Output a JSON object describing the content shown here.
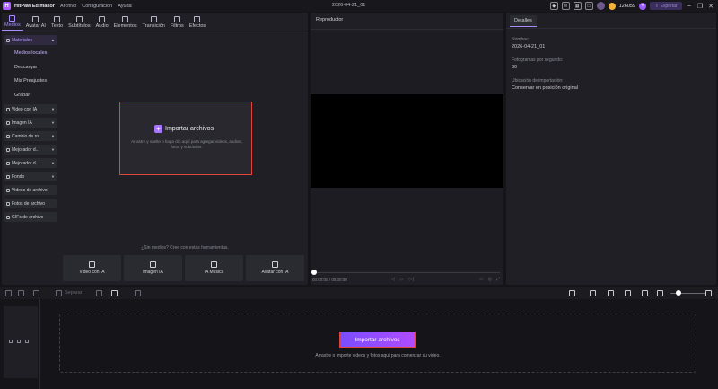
{
  "app": {
    "name": "HitPaw Edimakor",
    "project_title": "2026-04-21_01",
    "menu": [
      "Archivo",
      "Configuración",
      "Ayuda"
    ],
    "credits": "126059",
    "export_label": "Exportar"
  },
  "toolbar": {
    "tools": [
      {
        "label": "Medios",
        "icon": "folder-icon"
      },
      {
        "label": "Avatar AI",
        "icon": "avatar-icon"
      },
      {
        "label": "Texto",
        "icon": "text-icon"
      },
      {
        "label": "Subtítulos",
        "icon": "subtitles-icon"
      },
      {
        "label": "Audio",
        "icon": "music-icon"
      },
      {
        "label": "Elementos",
        "icon": "elements-icon"
      },
      {
        "label": "Transición",
        "icon": "transition-icon"
      },
      {
        "label": "Filtros",
        "icon": "filter-icon"
      },
      {
        "label": "Efectos",
        "icon": "effects-icon"
      }
    ]
  },
  "sidebar": {
    "materiales": "Materiales",
    "sub_items": [
      "Medios locales",
      "Descargar",
      "Mis Preajustes",
      "Grabar"
    ],
    "groups": [
      "Video con IA",
      "Imagen IA",
      "Cambio de ro...",
      "Mejorador d...",
      "Mejorador d...",
      "Fondo",
      "Videos de archivo",
      "Fotos de archivo",
      "GIFs de archivo"
    ]
  },
  "import": {
    "title": "Importar archivos",
    "desc": "Arrastre y suelte o haga clic aquí para agregar videos, audios, fotos y subtítulos."
  },
  "nomedia": {
    "text": "¿Sin medios? Cree con estas herramientas.",
    "cards": [
      "Video con IA",
      "Imagen IA",
      "IA Música",
      "Avatar con IA"
    ]
  },
  "player": {
    "title": "Reproductor",
    "time": "00:00:00 / 00:00:00"
  },
  "details": {
    "tab": "Detalles",
    "name_label": "Nombre:",
    "name_value": "2026-04-21_01",
    "fps_label": "Fotogramas por segundo:",
    "fps_value": "30",
    "location_label": "Ubicación de importación:",
    "location_value": "Conservar en posición original"
  },
  "timeline": {
    "split_label": "Separar",
    "import_button": "Importar archivos",
    "desc": "Arrastre o importe videos y fotos aquí para comenzar su video."
  },
  "colors": {
    "accent": "#a98cff",
    "highlight_border": "#e0443a",
    "button_gradient_start": "#7a4dff",
    "button_gradient_end": "#b04cff"
  }
}
